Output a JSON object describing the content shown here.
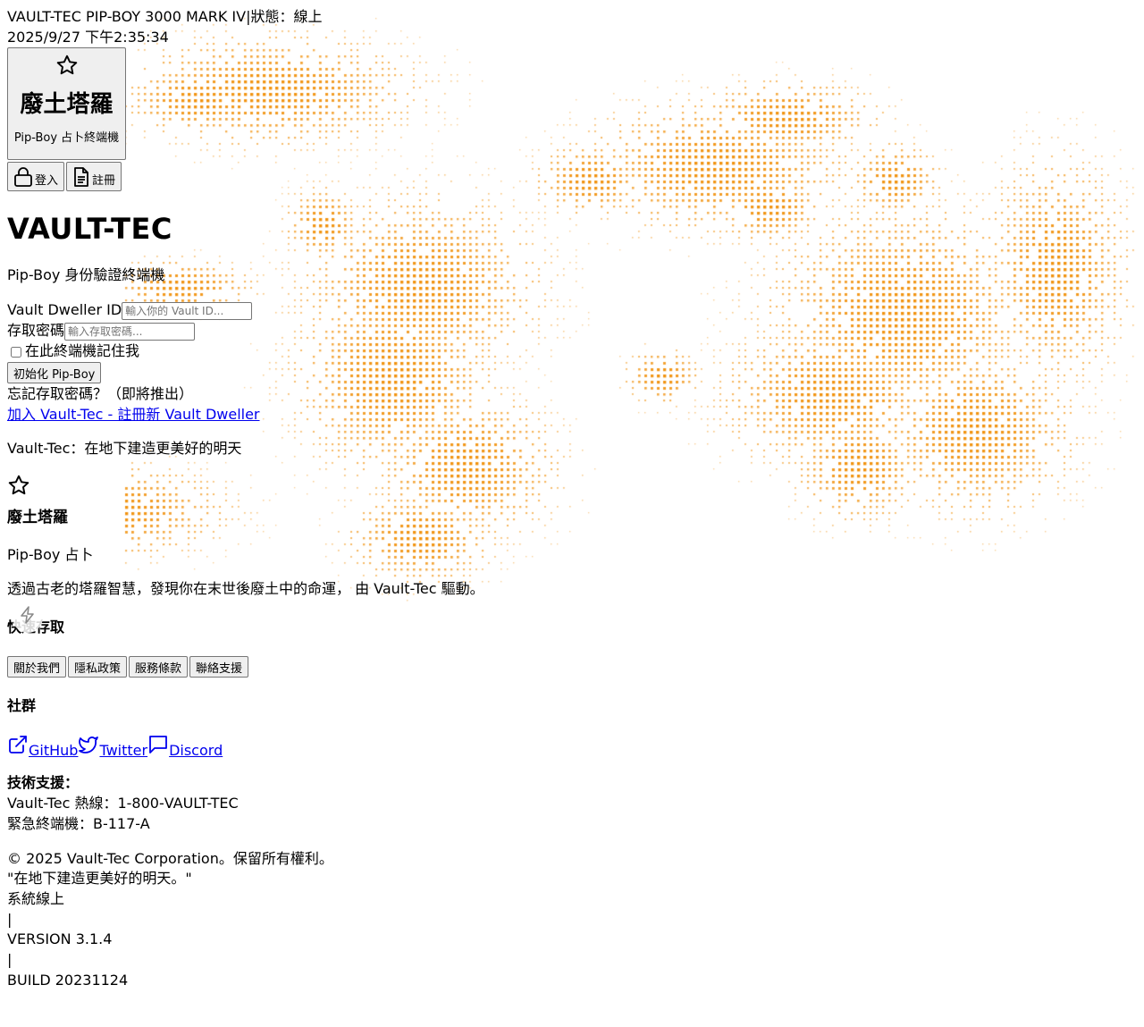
{
  "status_bar": {
    "device": "VAULT-TEC PIP-BOY 3000 MARK IV",
    "separator": "|",
    "status": "狀態：線上",
    "datetime": "2025/9/27 下午2:35:34"
  },
  "logo": {
    "icon": "star-icon",
    "title": "廢土塔羅",
    "subtitle": "Pip-Boy 占卜終端機"
  },
  "auth_nav": {
    "login_icon": "lock-icon",
    "login_label": "登入",
    "register_icon": "document-icon",
    "register_label": "註冊"
  },
  "login": {
    "brand": "VAULT-TEC",
    "subtitle": "Pip-Boy 身份驗證終端機",
    "id_label": "Vault Dweller ID",
    "id_placeholder": "輸入你的 Vault ID...",
    "password_label": "存取密碼",
    "password_placeholder": "輸入存取密碼...",
    "remember_label": "在此終端機記住我",
    "remember_checked": false,
    "submit_label": "初始化 Pip-Boy",
    "forgot_text": "忘記存取密碼？（即將推出）",
    "register_link": "加入 Vault-Tec - 註冊新 Vault Dweller",
    "slogan": "Vault-Tec：在地下建造更美好的明天"
  },
  "footer": {
    "icon": "star-icon",
    "title": "廢土塔羅",
    "subtitle": "Pip-Boy 占卜",
    "description": "透過古老的塔羅智慧，發現你在末世後廢土中的命運， 由 Vault-Tec 驅動。",
    "quick_access_heading": "快速存取",
    "quick_links": [
      "關於我們",
      "隱私政策",
      "服務條款",
      "聯絡支援"
    ],
    "community_heading": "社群",
    "social": [
      {
        "icon": "external-link-icon",
        "label": "GitHub"
      },
      {
        "icon": "twitter-bird-icon",
        "label": "Twitter"
      },
      {
        "icon": "chat-bubble-icon",
        "label": "Discord"
      }
    ],
    "support_heading": "技術支援：",
    "hotline": "Vault-Tec 熱線：1-800-VAULT-TEC",
    "emergency": "緊急終端機：B-117-A",
    "copyright": "© 2025 Vault-Tec Corporation。保留所有權利。",
    "quote": "\"在地下建造更美好的明天。\"",
    "system_status": "系統線上",
    "sep1": "|",
    "version": "VERSION 3.1.4",
    "sep2": "|",
    "build": "BUILD 20231124"
  },
  "overlay": {
    "icon": "lightning-bolt-icon"
  },
  "colors": {
    "accent_orange": "#f08c00",
    "link_blue": "#0000ee",
    "button_gray": "#efefef"
  }
}
